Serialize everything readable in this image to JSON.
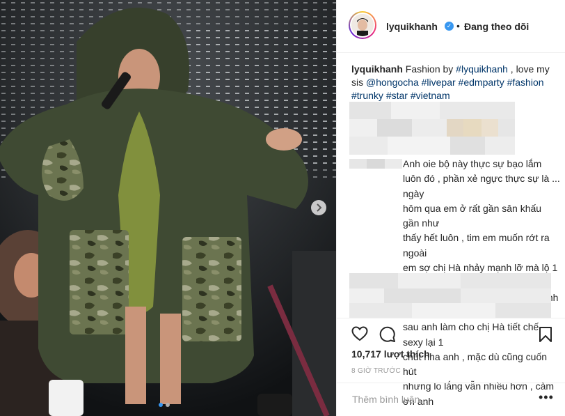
{
  "header": {
    "username": "lyquikhanh",
    "separator": "•",
    "follow_status": "Đang theo dõi"
  },
  "caption": {
    "username": "lyquikhanh",
    "text_prefix": "Fashion by",
    "mention_1": "#lyquikhanh",
    "text_mid": ", love my sis",
    "mention_2": "@hongocha",
    "hashtags": [
      "#livepar",
      "#edmparty",
      "#fashion",
      "#trunky",
      "#star",
      "#vietnam"
    ]
  },
  "comment": {
    "text": "Anh oie bộ này thực sự bạo lắm\nluôn đó , phần xẻ ngực thực sự là ... ngày\nhôm qua em ở rất gần sân khấu gần như\nthấy hết luôn , tim em muốn rớt ra ngoài\nem sợ chị Hà nhảy mạnh lỡ mà lộ 1 phát là\ntoi ngay , mém 1 tý nữa thoii đó anh , lần\nsau anh làm cho chị Hà tiết chế sexy lại 1\nchút nha anh , mặc dù cũng cuốn hút\nnhưng lo lắng vẫn nhiều hơn , cảm ơn anh"
  },
  "stats": {
    "likes": "10,717 lượt thích",
    "time_ago": "8 GIỜ TRƯỚC"
  },
  "add_comment": {
    "placeholder": "Thêm bình luận..."
  },
  "icons": {
    "like": "heart-icon",
    "comment": "comment-icon",
    "save": "bookmark-icon",
    "more": "more-options-icon",
    "next": "chevron-right-icon",
    "verified": "verified-badge-icon"
  },
  "carousel": {
    "slide_count": 2,
    "active_slide": 1
  },
  "colors": {
    "accent": "#3897f0",
    "text": "#262626",
    "muted": "#999999",
    "hashtag": "#003569"
  }
}
